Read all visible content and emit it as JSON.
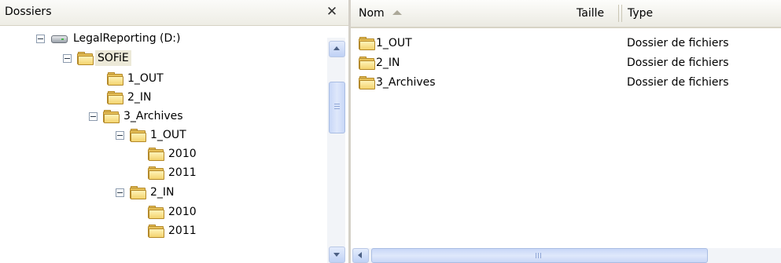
{
  "folders_pane": {
    "title": "Dossiers",
    "close_glyph": "✕"
  },
  "tree": {
    "nodes": [
      {
        "label": "LegalReporting (D:)",
        "icon": "hard-drive-icon",
        "expanded": true
      },
      {
        "label": "SOFiE",
        "icon": "folder-icon",
        "expanded": true,
        "selected": true
      },
      {
        "label": "1_OUT",
        "icon": "folder-icon"
      },
      {
        "label": "2_IN",
        "icon": "folder-icon"
      },
      {
        "label": "3_Archives",
        "icon": "folder-icon",
        "expanded": true
      },
      {
        "label": "1_OUT",
        "icon": "folder-icon",
        "expanded": true
      },
      {
        "label": "2010",
        "icon": "folder-icon"
      },
      {
        "label": "2011",
        "icon": "folder-icon"
      },
      {
        "label": "2_IN",
        "icon": "folder-icon",
        "expanded": true
      },
      {
        "label": "2010",
        "icon": "folder-icon"
      },
      {
        "label": "2011",
        "icon": "folder-icon"
      }
    ]
  },
  "file_list": {
    "columns": {
      "name": "Nom",
      "size": "Taille",
      "type": "Type"
    },
    "sort": {
      "column": "Nom",
      "direction": "ascending"
    },
    "rows": [
      {
        "name": "1_OUT",
        "size": "",
        "type": "Dossier de fichiers"
      },
      {
        "name": "2_IN",
        "size": "",
        "type": "Dossier de fichiers"
      },
      {
        "name": "3_Archives",
        "size": "",
        "type": "Dossier de fichiers"
      }
    ]
  },
  "colors": {
    "folder": "#e8c25a",
    "selection": "#ece9d8",
    "scrollbar": "#c8d7f7"
  }
}
